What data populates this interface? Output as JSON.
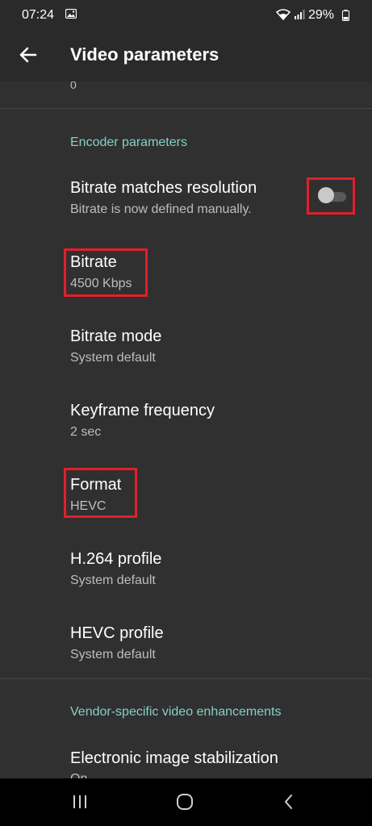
{
  "status_bar": {
    "time": "07:24",
    "battery_percent": "29%",
    "icons": [
      "image-icon",
      "wifi-icon",
      "signal-icon",
      "battery-icon"
    ]
  },
  "app_bar": {
    "title": "Video parameters",
    "back_icon": "arrow-left-icon"
  },
  "previous_item": {
    "summary": "0"
  },
  "sections": [
    {
      "header": "Encoder parameters",
      "items": [
        {
          "title": "Bitrate matches resolution",
          "summary": "Bitrate is now defined manually.",
          "toggle": false
        },
        {
          "title": "Bitrate",
          "summary": "4500 Kbps"
        },
        {
          "title": "Bitrate mode",
          "summary": "System default"
        },
        {
          "title": "Keyframe frequency",
          "summary": "2 sec"
        },
        {
          "title": "Format",
          "summary": "HEVC"
        },
        {
          "title": "H.264 profile",
          "summary": "System default"
        },
        {
          "title": "HEVC profile",
          "summary": "System default"
        }
      ]
    },
    {
      "header": "Vendor-specific video enhancements",
      "items": [
        {
          "title": "Electronic image stabilization",
          "summary": "On"
        }
      ]
    }
  ],
  "nav_bar": {
    "icons": [
      "recent-apps-icon",
      "home-icon",
      "back-icon"
    ]
  },
  "colors": {
    "background": "#303030",
    "app_bar": "#2a2a2a",
    "accent": "#86d0c5",
    "highlight": "#e21f2b"
  }
}
